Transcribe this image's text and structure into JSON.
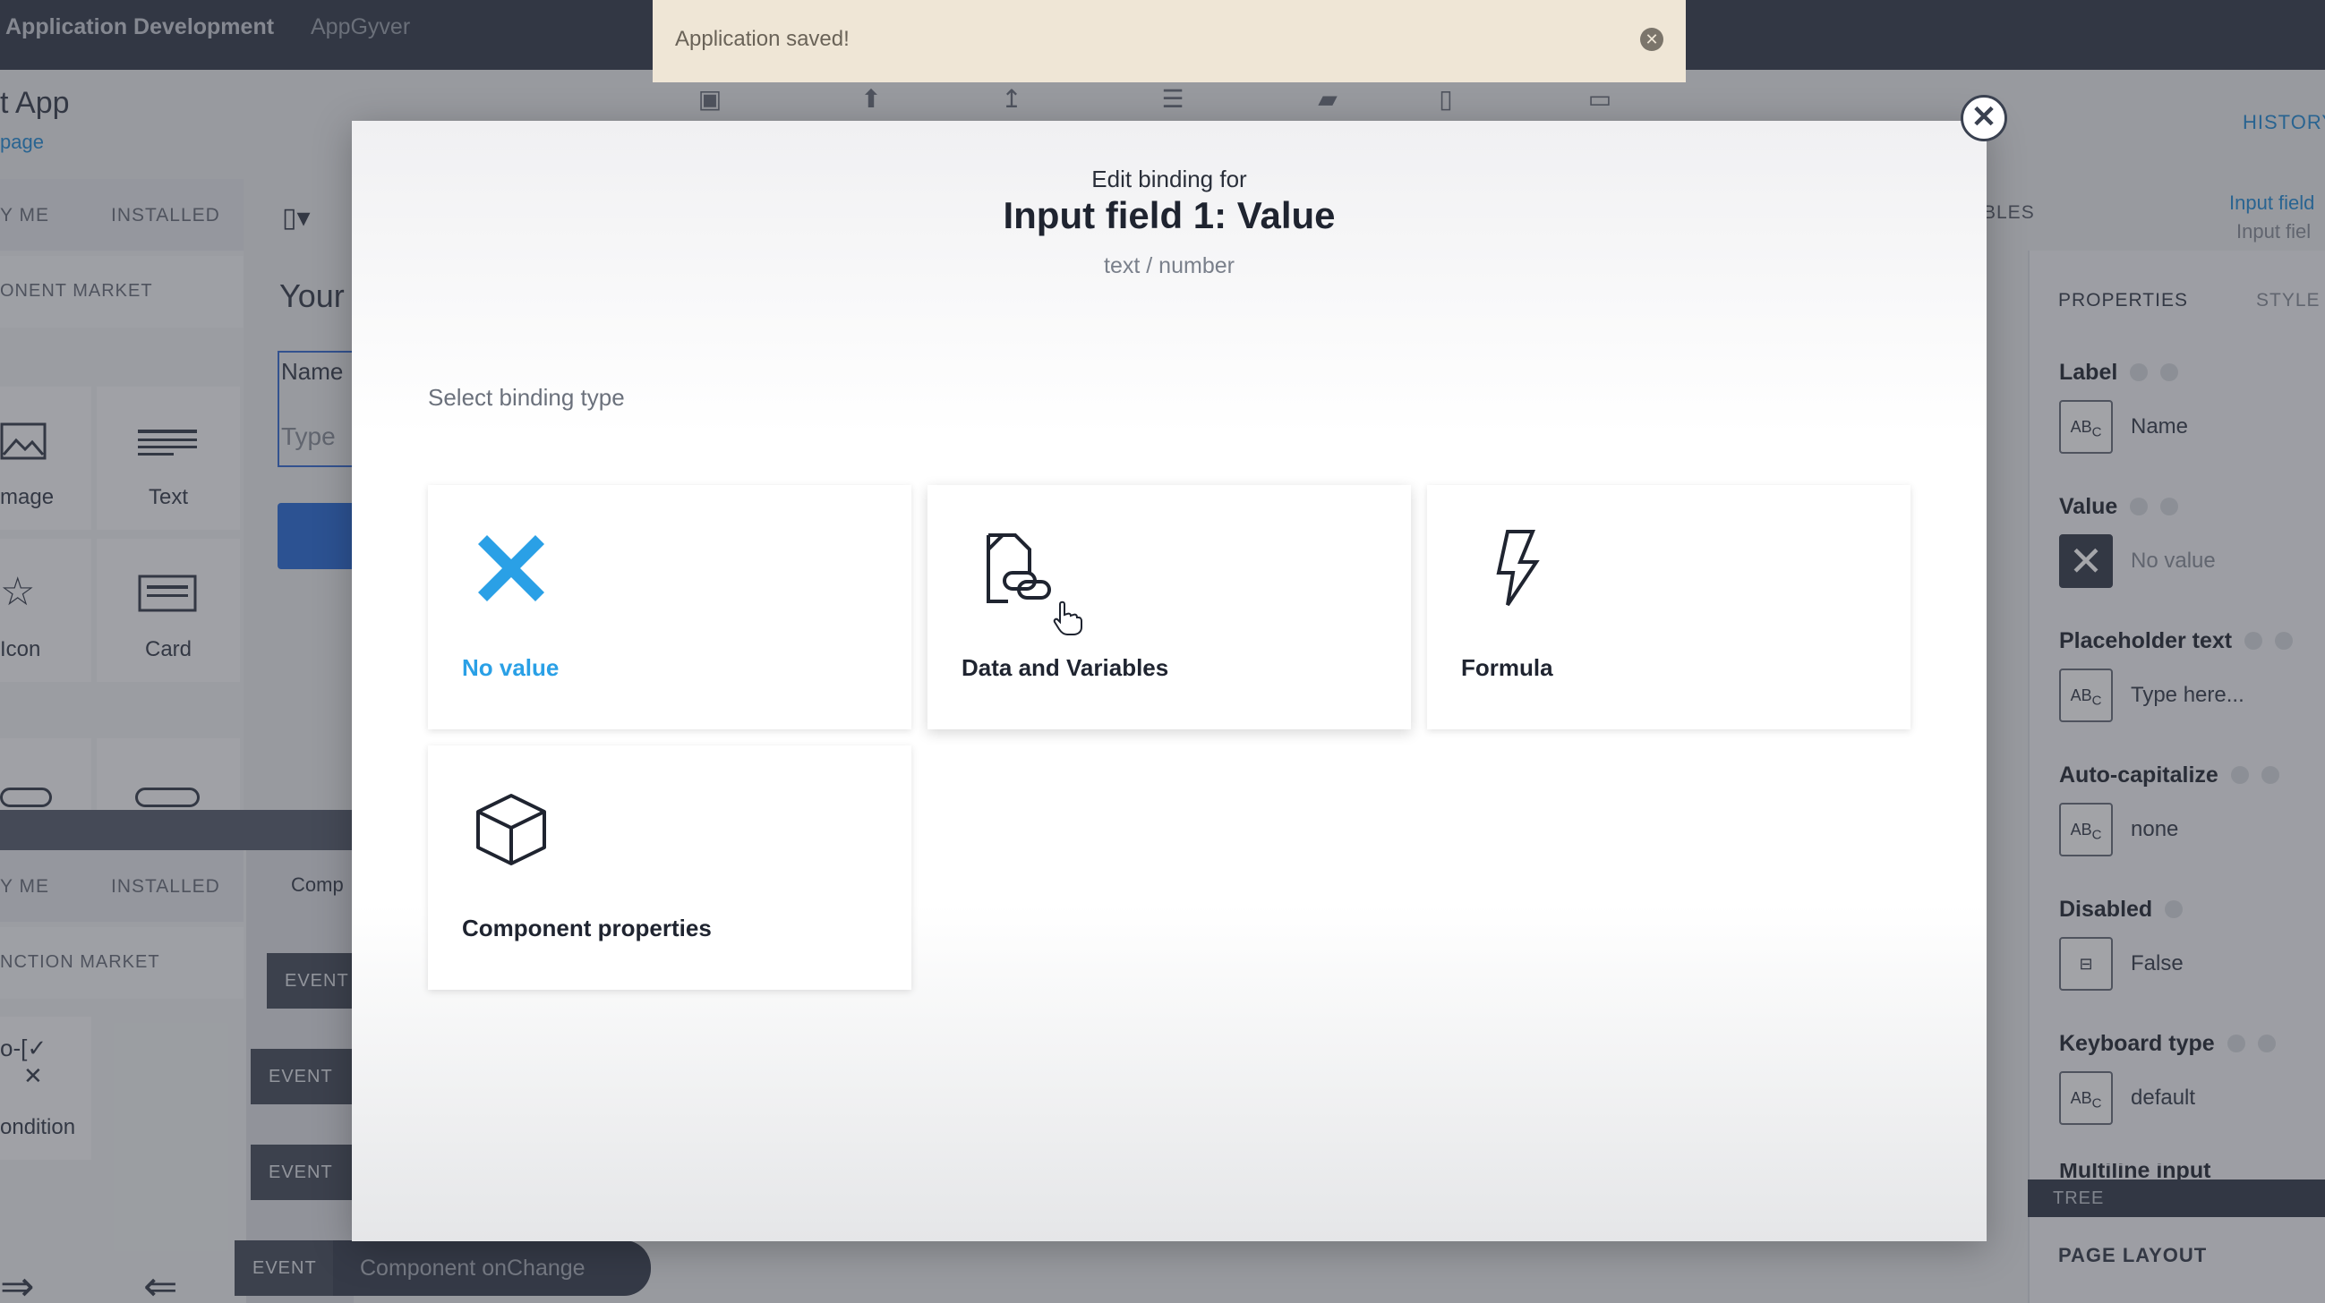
{
  "topbar": {
    "title": "Application Development",
    "subtitle": "AppGyver"
  },
  "toast": {
    "message": "Application saved!"
  },
  "app": {
    "name": "t App",
    "link": "page"
  },
  "left_panel": {
    "tabs": [
      "Y ME",
      "INSTALLED"
    ],
    "market": "ONENT MARKET",
    "tiles": [
      "mage",
      "Text",
      "Icon",
      "Card"
    ],
    "tabs2": [
      "Y ME",
      "INSTALLED",
      "Comp"
    ],
    "market2": "NCTION MARKET",
    "logic_tile": "ondition"
  },
  "canvas": {
    "heading": "Your",
    "name_label": "Name",
    "type_placeholder": "Type"
  },
  "events": {
    "buttons": [
      "EVENT",
      "EVENT",
      "EVENT",
      "EVENT"
    ],
    "onchange": "Component onChange"
  },
  "right_panel": {
    "history": "HISTORY",
    "input_field_link": "Input field",
    "input_field_sub": "Input fiel",
    "bles": "BLES",
    "tabs": [
      "PROPERTIES",
      "STYLE"
    ],
    "properties": [
      {
        "label": "Label",
        "icon": "ABC",
        "value": "Name"
      },
      {
        "label": "Value",
        "icon": "x",
        "value": "No value"
      },
      {
        "label": "Placeholder text",
        "icon": "ABC",
        "value": "Type here..."
      },
      {
        "label": "Auto-capitalize",
        "icon": "ABC",
        "value": "none"
      },
      {
        "label": "Disabled",
        "icon": "toggle",
        "value": "False"
      },
      {
        "label": "Keyboard type",
        "icon": "ABC",
        "value": "default"
      },
      {
        "label": "Multiline input",
        "icon": "",
        "value": ""
      }
    ],
    "tree": "TREE",
    "page_layout": "PAGE LAYOUT"
  },
  "modal": {
    "edit_label": "Edit binding for",
    "title": "Input field 1: Value",
    "type": "text / number",
    "select_label": "Select binding type",
    "options": [
      {
        "label": "No value",
        "icon": "x-icon",
        "color": "#2aa0e6"
      },
      {
        "label": "Data and Variables",
        "icon": "data-link-icon"
      },
      {
        "label": "Formula",
        "icon": "lightning-icon"
      },
      {
        "label": "Component properties",
        "icon": "cube-icon"
      }
    ]
  },
  "colors": {
    "accent": "#2aa0e6",
    "topbar": "#3a4150",
    "toast": "#efe6d6"
  }
}
